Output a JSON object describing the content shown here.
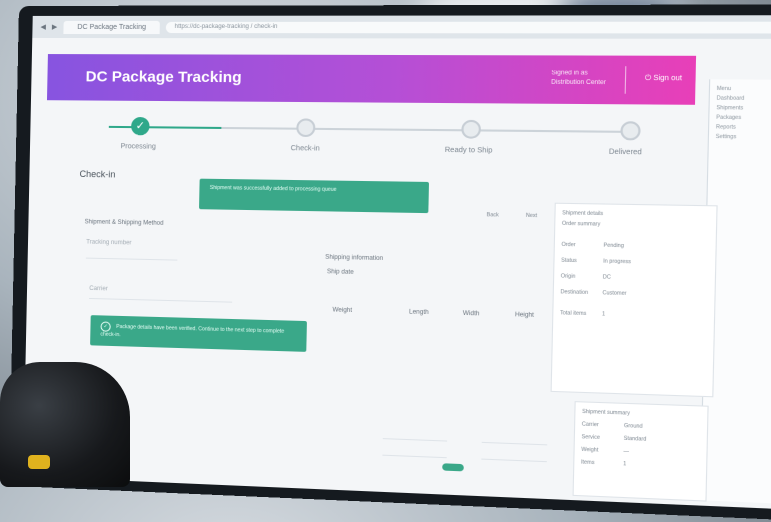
{
  "browser": {
    "tabs": [
      "DC Package Tracking"
    ],
    "url": "https://dc-package-tracking / check-in"
  },
  "banner": {
    "title": "DC Package Tracking",
    "user_line1": "Signed in as",
    "user_line2": "Distribution Center",
    "signout_label": "Sign out"
  },
  "stepper": {
    "steps": [
      {
        "label": "Processing",
        "state": "done"
      },
      {
        "label": "Check-in",
        "state": "pending"
      },
      {
        "label": "Ready to Ship",
        "state": "pending"
      },
      {
        "label": "Delivered",
        "state": "pending"
      }
    ]
  },
  "checkin": {
    "title": "Check-in",
    "toast_top": "Shipment was successfully added to processing queue",
    "toast_bottom": "Package details have been verified. Continue to the next step to complete check-in.",
    "shipment_label": "Shipment & Shipping Method",
    "tracking_label": "Tracking number",
    "carrier_label": "Carrier",
    "shipping_info_label": "Shipping information",
    "ship_date_label": "Ship date",
    "cols": [
      "Weight",
      "Length",
      "Width",
      "Height"
    ],
    "action_prev": "Back",
    "action_next": "Next"
  },
  "details_card": {
    "title": "Shipment details",
    "subtitle": "Order summary",
    "rows": [
      {
        "k": "Order",
        "v": "Pending"
      },
      {
        "k": "Status",
        "v": "In progress"
      },
      {
        "k": "Origin",
        "v": "DC"
      },
      {
        "k": "Destination",
        "v": "Customer"
      }
    ],
    "footer_label": "Total items",
    "footer_value": "1"
  },
  "summary_card": {
    "title": "Shipment summary",
    "rows": [
      {
        "k": "Carrier",
        "v": "Ground"
      },
      {
        "k": "Service",
        "v": "Standard"
      },
      {
        "k": "Weight",
        "v": "—"
      },
      {
        "k": "Items",
        "v": "1"
      }
    ]
  },
  "right_panel": {
    "items": [
      "Menu",
      "Dashboard",
      "Shipments",
      "Packages",
      "Reports",
      "Settings"
    ]
  },
  "colors": {
    "accent_green": "#3aa889",
    "banner_start": "#8754e0",
    "banner_end": "#e83fb8"
  }
}
